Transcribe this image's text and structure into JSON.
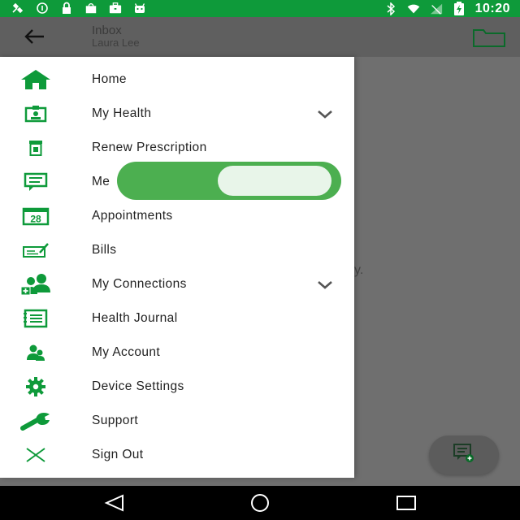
{
  "status_bar": {
    "time": "10:20",
    "left_icons": [
      "satellite-icon",
      "info-circle-icon",
      "lock-icon",
      "shopping-bag-icon",
      "briefcase-icon",
      "android-icon"
    ],
    "right_icons": [
      "bluetooth-icon",
      "wifi-icon",
      "signal-icon",
      "battery-charging-icon"
    ]
  },
  "toolbar": {
    "title": "Inbox",
    "subtitle": "Laura Lee"
  },
  "content": {
    "fragment": "y."
  },
  "drawer": {
    "items": [
      {
        "label": "Home",
        "icon": "home-icon",
        "expandable": false
      },
      {
        "label": "My Health",
        "icon": "id-badge-icon",
        "expandable": true
      },
      {
        "label": "Renew Prescription",
        "icon": "prescription-icon",
        "expandable": false
      },
      {
        "label": "Me",
        "icon": "message-icon",
        "expandable": false
      },
      {
        "label": "Appointments",
        "icon": "calendar-icon",
        "expandable": false
      },
      {
        "label": "Bills",
        "icon": "check-bill-icon",
        "expandable": false
      },
      {
        "label": "My Connections",
        "icon": "connections-icon",
        "expandable": true
      },
      {
        "label": "Health Journal",
        "icon": "journal-icon",
        "expandable": false
      },
      {
        "label": "My Account",
        "icon": "account-icon",
        "expandable": false
      },
      {
        "label": "Device Settings",
        "icon": "gear-icon",
        "expandable": false
      },
      {
        "label": "Support",
        "icon": "wrench-icon",
        "expandable": false
      },
      {
        "label": "Sign Out",
        "icon": "close-icon",
        "expandable": false
      }
    ],
    "calendar_day": "28"
  },
  "toggle": {
    "state": "on"
  },
  "colors": {
    "brand_green": "#0e9a3a",
    "toggle_green": "#4caf50",
    "toggle_knob": "#e8f5e9"
  }
}
